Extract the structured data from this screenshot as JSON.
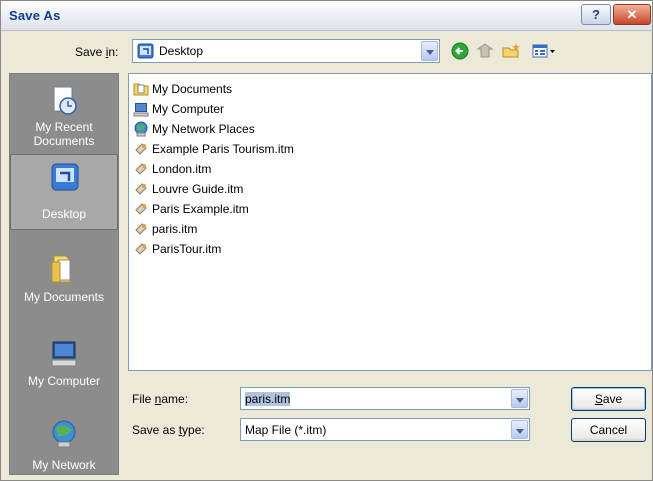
{
  "window": {
    "title": "Save As"
  },
  "save_in": {
    "label_pre": "Save ",
    "label_key": "i",
    "label_post": "n:",
    "value": "Desktop"
  },
  "places": [
    {
      "label_line1": "My Recent",
      "label_line2": "Documents"
    },
    {
      "label_line1": "Desktop",
      "label_line2": ""
    },
    {
      "label_line1": "My Documents",
      "label_line2": ""
    },
    {
      "label_line1": "My Computer",
      "label_line2": ""
    },
    {
      "label_line1": "My Network",
      "label_line2": ""
    }
  ],
  "files": [
    {
      "name": "My Documents",
      "icon": "folder-docs-icon"
    },
    {
      "name": "My Computer",
      "icon": "computer-icon"
    },
    {
      "name": "My Network Places",
      "icon": "network-icon"
    },
    {
      "name": "Example Paris Tourism.itm",
      "icon": "itm-file-icon"
    },
    {
      "name": "London.itm",
      "icon": "itm-file-icon"
    },
    {
      "name": "Louvre Guide.itm",
      "icon": "itm-file-icon"
    },
    {
      "name": "Paris Example.itm",
      "icon": "itm-file-icon"
    },
    {
      "name": "paris.itm",
      "icon": "itm-file-icon"
    },
    {
      "name": "ParisTour.itm",
      "icon": "itm-file-icon"
    }
  ],
  "file_name": {
    "label_pre": "File ",
    "label_key": "n",
    "label_post": "ame:",
    "value": "paris.itm"
  },
  "save_as_type": {
    "label_pre": "Save as ",
    "label_key": "t",
    "label_post": "ype:",
    "value": "Map File (*.itm)"
  },
  "buttons": {
    "save_key": "S",
    "save_rest": "ave",
    "cancel": "Cancel"
  },
  "colors": {
    "places_bg": "#8c8c8c",
    "dialog_bg": "#ece9d8",
    "title_text": "#0b3d91"
  }
}
